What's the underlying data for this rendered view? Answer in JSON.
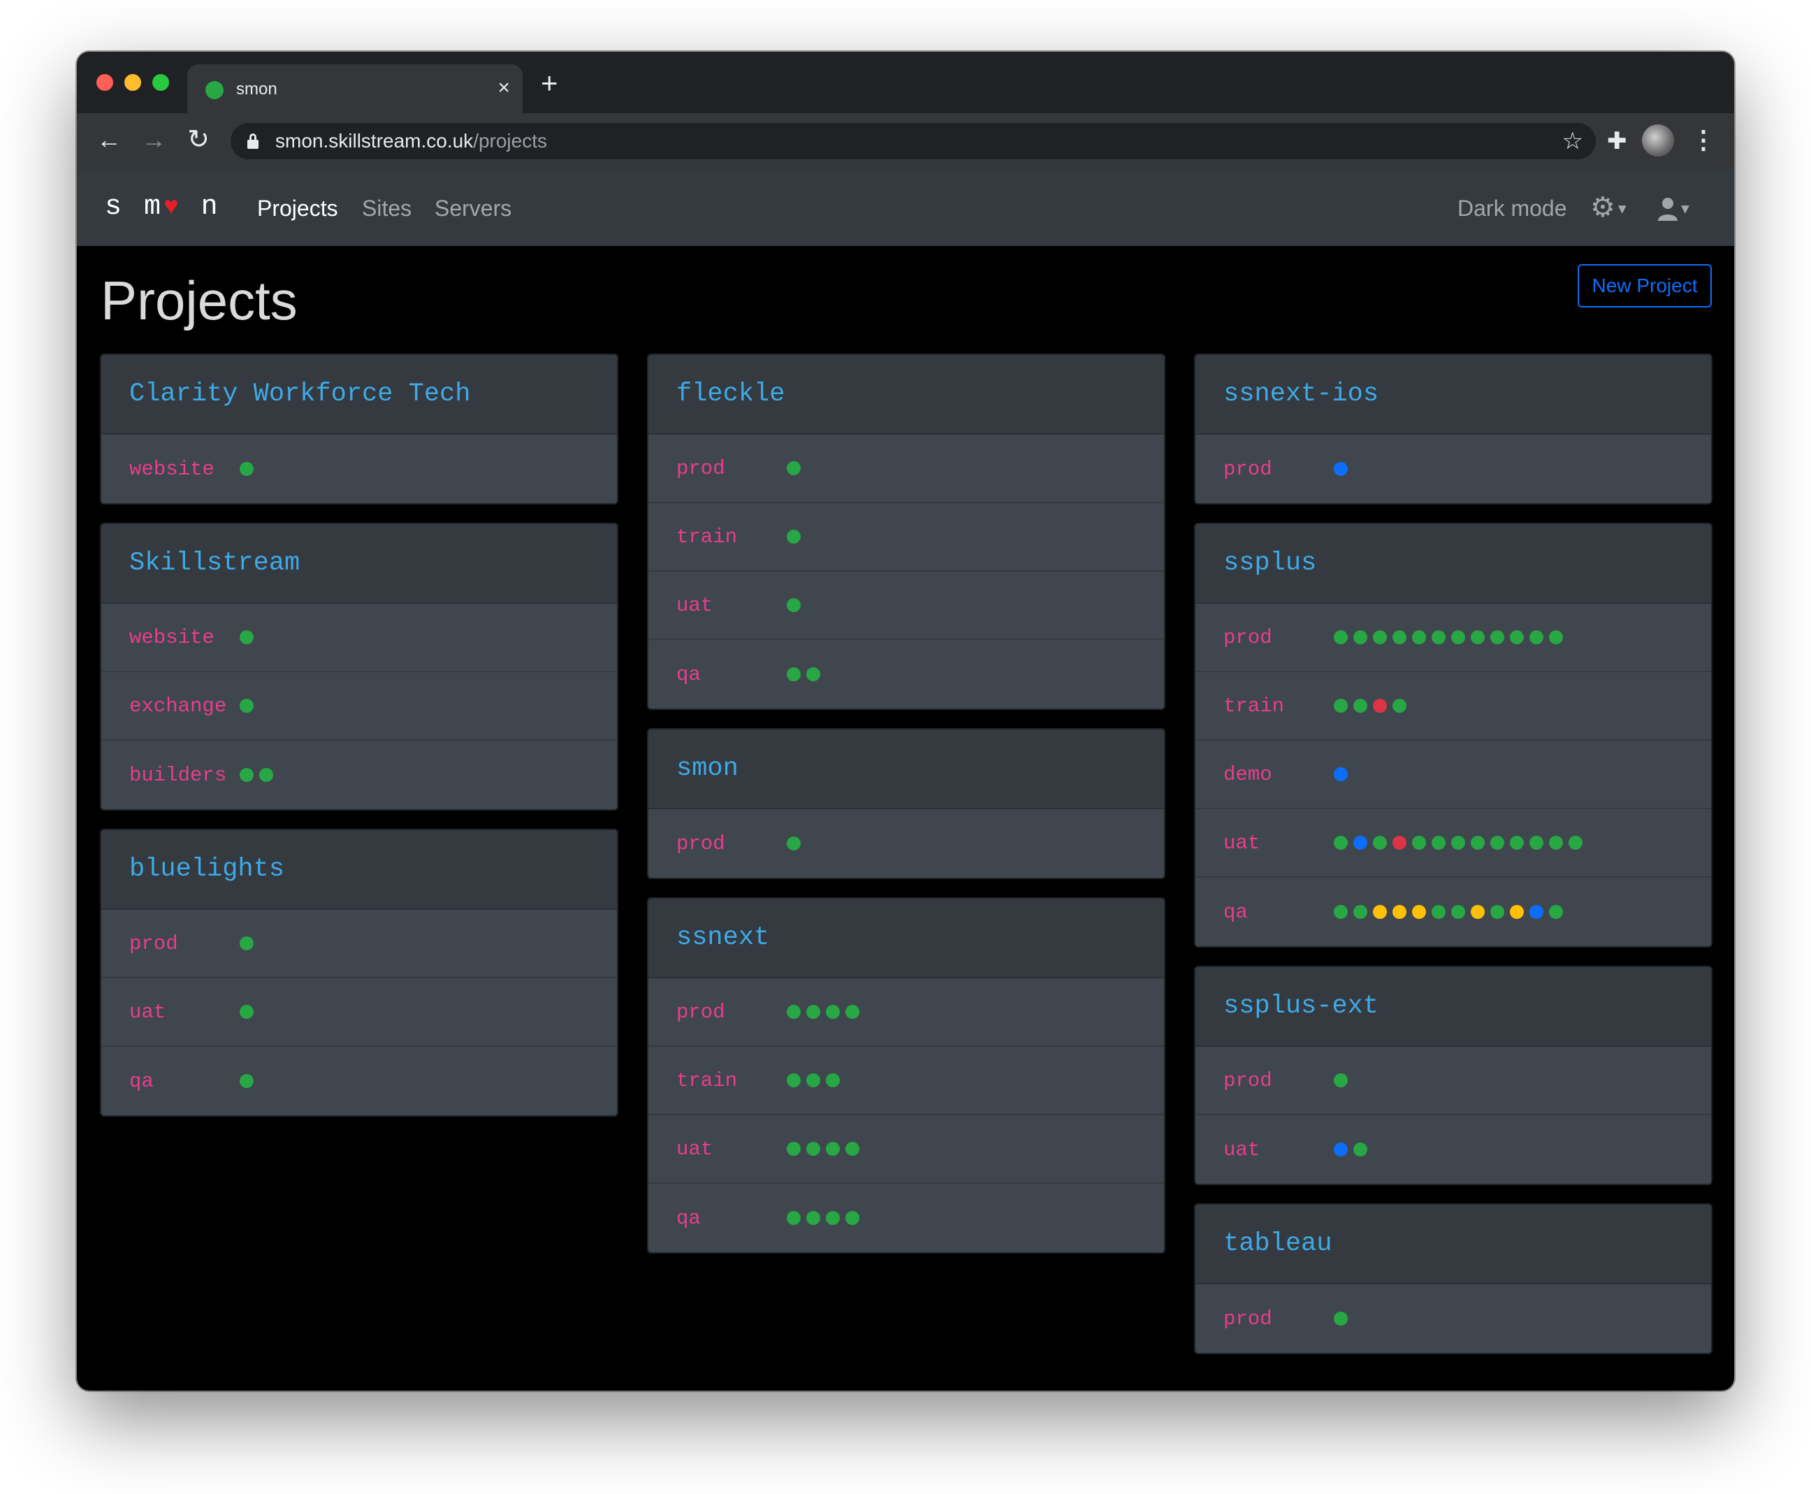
{
  "browser": {
    "tab_title": "smon",
    "tab_close": "×",
    "new_tab": "+",
    "url_host": "smon.skillstream.co.uk",
    "url_path": "/projects"
  },
  "navbar": {
    "brand_start": "s m",
    "brand_heart": "♥",
    "brand_end": " n",
    "links": [
      "Projects",
      "Sites",
      "Servers"
    ],
    "active_link": "Projects",
    "dark_mode": "Dark mode"
  },
  "page": {
    "title": "Projects",
    "new_project_label": "New Project"
  },
  "status_colors": {
    "green": "#28a745",
    "blue": "#0d6efd",
    "red": "#dc3545",
    "yellow": "#ffc107"
  },
  "columns": [
    [
      {
        "name": "Clarity Workforce Tech",
        "sites": [
          {
            "name": "website",
            "statuses": [
              "green"
            ]
          }
        ]
      },
      {
        "name": "Skillstream",
        "sites": [
          {
            "name": "website",
            "statuses": [
              "green"
            ]
          },
          {
            "name": "exchange",
            "statuses": [
              "green"
            ]
          },
          {
            "name": "builders",
            "statuses": [
              "green",
              "green"
            ]
          }
        ]
      },
      {
        "name": "bluelights",
        "sites": [
          {
            "name": "prod",
            "statuses": [
              "green"
            ]
          },
          {
            "name": "uat",
            "statuses": [
              "green"
            ]
          },
          {
            "name": "qa",
            "statuses": [
              "green"
            ]
          }
        ]
      }
    ],
    [
      {
        "name": "fleckle",
        "sites": [
          {
            "name": "prod",
            "statuses": [
              "green"
            ]
          },
          {
            "name": "train",
            "statuses": [
              "green"
            ]
          },
          {
            "name": "uat",
            "statuses": [
              "green"
            ]
          },
          {
            "name": "qa",
            "statuses": [
              "green",
              "green"
            ]
          }
        ]
      },
      {
        "name": "smon",
        "sites": [
          {
            "name": "prod",
            "statuses": [
              "green"
            ]
          }
        ]
      },
      {
        "name": "ssnext",
        "sites": [
          {
            "name": "prod",
            "statuses": [
              "green",
              "green",
              "green",
              "green"
            ]
          },
          {
            "name": "train",
            "statuses": [
              "green",
              "green",
              "green"
            ]
          },
          {
            "name": "uat",
            "statuses": [
              "green",
              "green",
              "green",
              "green"
            ]
          },
          {
            "name": "qa",
            "statuses": [
              "green",
              "green",
              "green",
              "green"
            ]
          }
        ]
      }
    ],
    [
      {
        "name": "ssnext-ios",
        "sites": [
          {
            "name": "prod",
            "statuses": [
              "blue"
            ]
          }
        ]
      },
      {
        "name": "ssplus",
        "sites": [
          {
            "name": "prod",
            "statuses": [
              "green",
              "green",
              "green",
              "green",
              "green",
              "green",
              "green",
              "green",
              "green",
              "green",
              "green",
              "green"
            ]
          },
          {
            "name": "train",
            "statuses": [
              "green",
              "green",
              "red",
              "green"
            ]
          },
          {
            "name": "demo",
            "statuses": [
              "blue"
            ]
          },
          {
            "name": "uat",
            "statuses": [
              "green",
              "blue",
              "green",
              "red",
              "green",
              "green",
              "green",
              "green",
              "green",
              "green",
              "green",
              "green",
              "green"
            ]
          },
          {
            "name": "qa",
            "statuses": [
              "green",
              "green",
              "yellow",
              "yellow",
              "yellow",
              "green",
              "green",
              "yellow",
              "green",
              "yellow",
              "blue",
              "green"
            ]
          }
        ]
      },
      {
        "name": "ssplus-ext",
        "sites": [
          {
            "name": "prod",
            "statuses": [
              "green"
            ]
          },
          {
            "name": "uat",
            "statuses": [
              "blue",
              "green"
            ]
          }
        ]
      },
      {
        "name": "tableau",
        "sites": [
          {
            "name": "prod",
            "statuses": [
              "green"
            ]
          }
        ]
      }
    ]
  ]
}
